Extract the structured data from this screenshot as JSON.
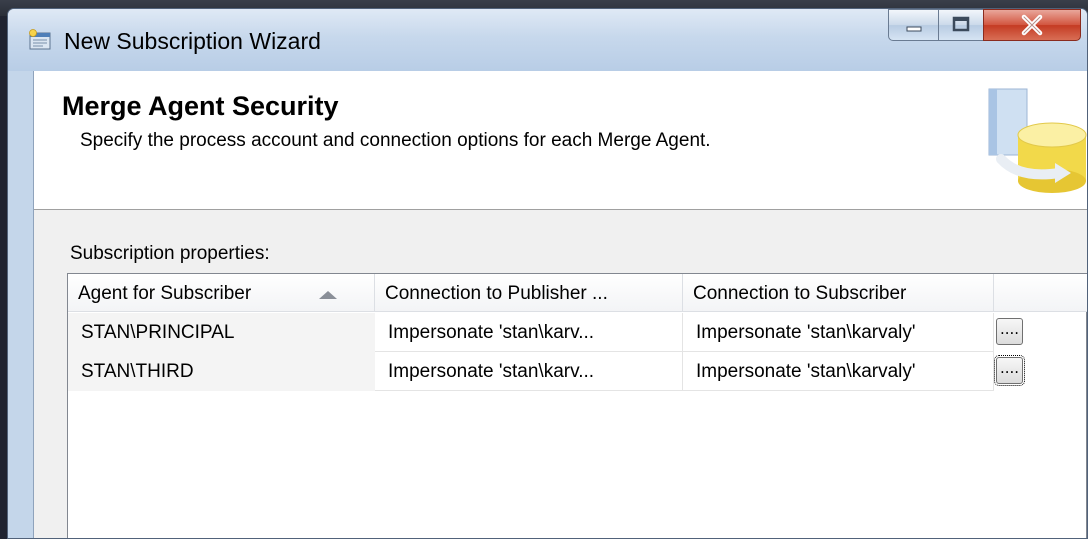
{
  "window": {
    "title": "New Subscription Wizard",
    "icon": "wizard-app-icon",
    "caption_buttons": [
      "minimize-icon",
      "maximize-icon",
      "close-icon"
    ]
  },
  "header": {
    "title": "Merge Agent Security",
    "description": "Specify the process account and connection options for each Merge Agent.",
    "art": "database-book-art"
  },
  "subscription_properties": {
    "label": "Subscription properties:",
    "columns": [
      "Agent for Subscriber",
      "Connection to Publisher ...",
      "Connection to Subscriber"
    ],
    "sort": {
      "column": "Agent for Subscriber",
      "direction": "ascending"
    },
    "rows": [
      {
        "agent": "STAN\\PRINCIPAL",
        "publisher": "Impersonate 'stan\\karv...",
        "subscriber": "Impersonate 'stan\\karvaly'",
        "button": "...."
      },
      {
        "agent": "STAN\\THIRD",
        "publisher": "Impersonate 'stan\\karv...",
        "subscriber": "Impersonate 'stan\\karvaly'",
        "button": "...."
      }
    ]
  },
  "colors": {
    "titlebar": "#c7d8ec",
    "close_button": "#c43b23",
    "header_bg": "#ffffff",
    "client_bg": "#f0f0f0"
  }
}
